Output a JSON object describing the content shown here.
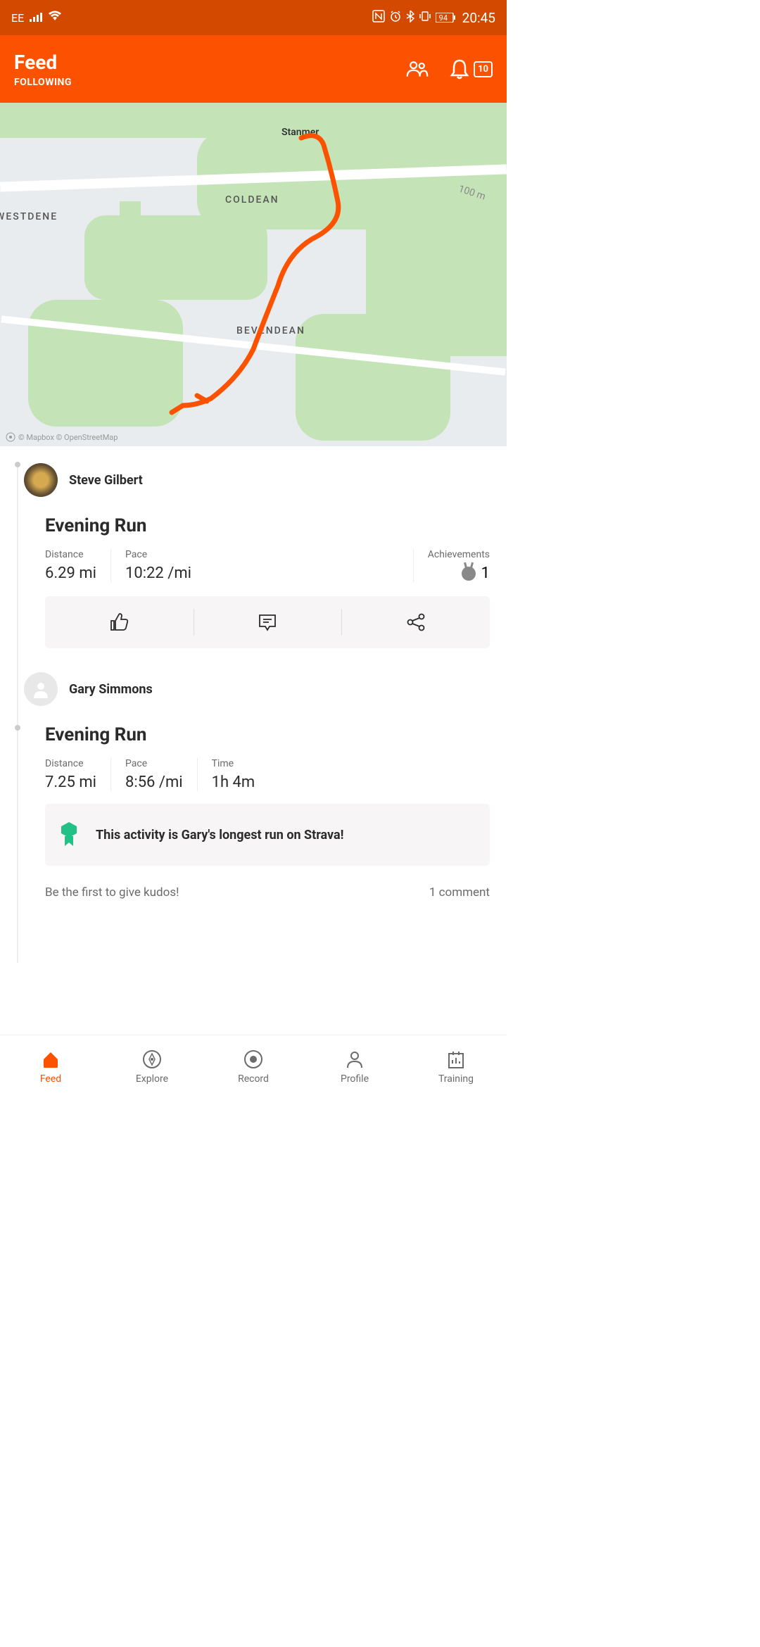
{
  "status": {
    "carrier": "EE",
    "battery": "94",
    "time": "20:45"
  },
  "header": {
    "title": "Feed",
    "subtitle": "FOLLOWING",
    "badge_count": "10"
  },
  "map": {
    "labels": {
      "stanmer": "Stanmer",
      "coldean": "COLDEAN",
      "westdene": "WESTDENE",
      "bevendean": "BEVENDEAN",
      "contour": "100 m"
    },
    "credit": "© Mapbox  © OpenStreetMap"
  },
  "activities": [
    {
      "user": "Steve Gilbert",
      "title": "Evening Run",
      "stats": {
        "distance_label": "Distance",
        "distance_value": "6.29 mi",
        "pace_label": "Pace",
        "pace_value": "10:22 /mi",
        "achievements_label": "Achievements",
        "achievements_value": "1"
      }
    },
    {
      "user": "Gary Simmons",
      "title": "Evening Run",
      "stats": {
        "distance_label": "Distance",
        "distance_value": "7.25 mi",
        "pace_label": "Pace",
        "pace_value": "8:56 /mi",
        "time_label": "Time",
        "time_value": "1h 4m"
      },
      "highlight": "This activity is Gary's longest run on Strava!",
      "kudos_prompt": "Be the first to give kudos!",
      "comments": "1 comment"
    }
  ],
  "nav": {
    "feed": "Feed",
    "explore": "Explore",
    "record": "Record",
    "profile": "Profile",
    "training": "Training"
  }
}
